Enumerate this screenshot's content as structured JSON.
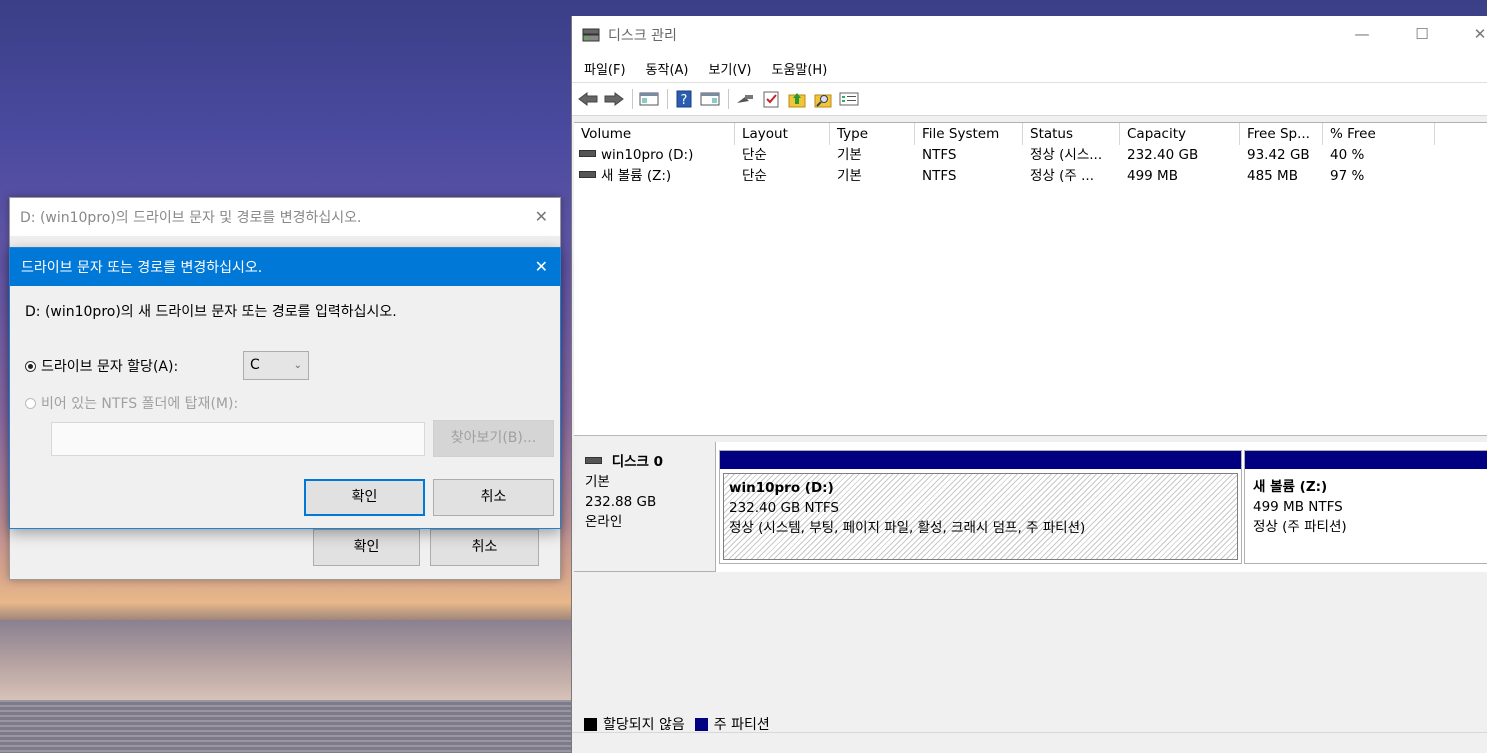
{
  "disk_mgmt": {
    "title": "디스크 관리",
    "window_buttons": {
      "minimize": "—",
      "maximize": "☐",
      "close": "✕"
    },
    "menu": [
      "파일(F)",
      "동작(A)",
      "보기(V)",
      "도움말(H)"
    ],
    "columns": [
      "Volume",
      "Layout",
      "Type",
      "File System",
      "Status",
      "Capacity",
      "Free Sp...",
      "% Free"
    ],
    "volumes": [
      {
        "name": "win10pro (D:)",
        "layout": "단순",
        "type": "기본",
        "fs": "NTFS",
        "status": "정상 (시스...",
        "capacity": "232.40 GB",
        "free": "93.42 GB",
        "pct": "40 %"
      },
      {
        "name": "새 볼륨 (Z:)",
        "layout": "단순",
        "type": "기본",
        "fs": "NTFS",
        "status": "정상 (주 ...",
        "capacity": "499 MB",
        "free": "485 MB",
        "pct": "97 %"
      }
    ],
    "disk0": {
      "name": "디스크 0",
      "type": "기본",
      "size": "232.88 GB",
      "state": "온라인",
      "part1": {
        "name": "win10pro  (D:)",
        "size": "232.40 GB NTFS",
        "status": "정상 (시스템, 부팅, 페이지 파일, 활성, 크래시 덤프, 주 파티션)"
      },
      "part2": {
        "name": "새 볼륨  (Z:)",
        "size": "499 MB NTFS",
        "status": "정상 (주 파티션)"
      }
    },
    "legend": {
      "unallocated": "할당되지 않음",
      "primary": "주 파티션",
      "unallocated_color": "#000000",
      "primary_color": "#000080"
    }
  },
  "dialog_bg": {
    "title": "D: (win10pro)의 드라이브 문자 및 경로를 변경하십시오.",
    "ok": "확인",
    "cancel": "취소"
  },
  "dialog_fg": {
    "title": "드라이브 문자 또는 경로를 변경하십시오.",
    "prompt": "D: (win10pro)의 새 드라이브 문자 또는 경로를 입력하십시오.",
    "radio_letter": "드라이브 문자 할당(A):",
    "drive_letter": "C",
    "radio_folder": "비어 있는 NTFS 폴더에 탑재(M):",
    "browse": "찾아보기(B)...",
    "ok": "확인",
    "cancel": "취소",
    "accent": "#0078d7"
  }
}
